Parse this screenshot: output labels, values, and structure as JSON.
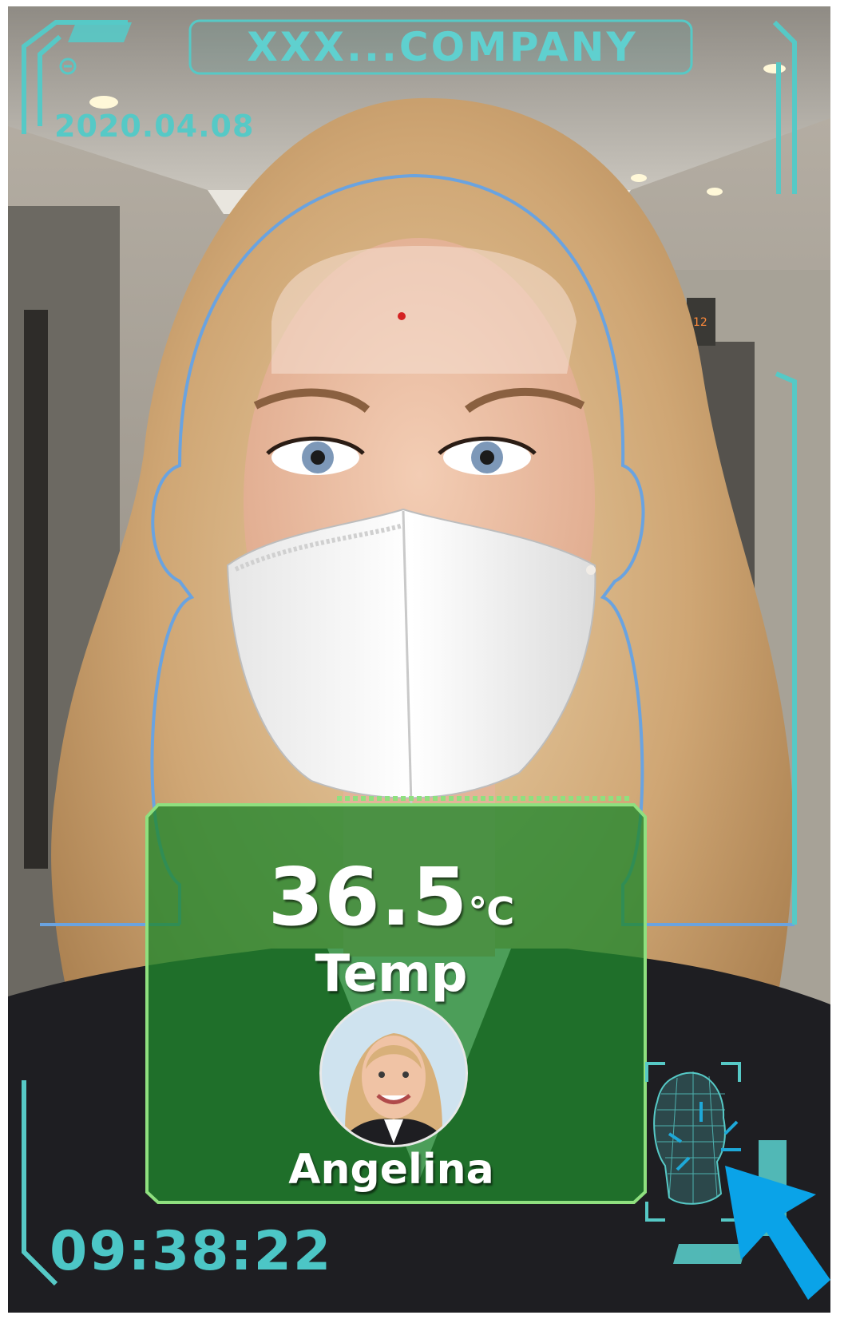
{
  "header": {
    "company": "XXX...COMPANY",
    "date": "2020.04.08"
  },
  "result": {
    "temperature": "36.5",
    "unit": "℃",
    "temp_label": "Temp",
    "name": "Angelina"
  },
  "footer": {
    "time": "09:38:22",
    "elevator_floor": "12"
  },
  "colors": {
    "hud_cyan": "#56c9c6",
    "hud_line_blue": "#6aa3e0",
    "panel_green": "#2f8a35",
    "cursor_blue": "#0aa3e8",
    "measure_dot": "#d42222"
  },
  "icons": [
    "face-scan-icon",
    "cursor-arrow-icon",
    "measure-point-icon"
  ]
}
